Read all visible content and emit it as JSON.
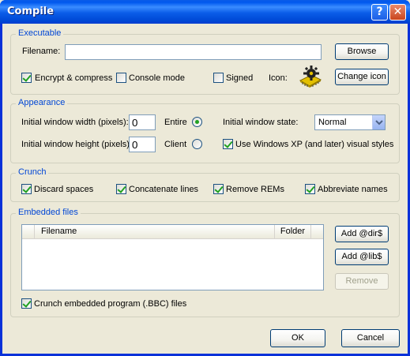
{
  "window": {
    "title": "Compile"
  },
  "titlebar": {
    "help_glyph": "?",
    "close_glyph": "✕"
  },
  "executable": {
    "group_title": "Executable",
    "filename_label": "Filename:",
    "filename_value": "",
    "browse_label": "Browse",
    "encrypt_label": "Encrypt & compress",
    "encrypt_checked": true,
    "console_label": "Console mode",
    "console_checked": false,
    "signed_label": "Signed",
    "signed_checked": false,
    "icon_label": "Icon:",
    "icon_name": "chip-gear-icon",
    "change_icon_label": "Change icon"
  },
  "appearance": {
    "group_title": "Appearance",
    "width_label": "Initial window width (pixels):",
    "width_value": "0",
    "height_label": "Initial window height (pixels):",
    "height_value": "0",
    "entire_label": "Entire",
    "entire_selected": true,
    "client_label": "Client",
    "client_selected": false,
    "state_label": "Initial window state:",
    "state_value": "Normal",
    "xp_styles_label": "Use Windows XP (and later) visual styles",
    "xp_styles_checked": true
  },
  "crunch": {
    "group_title": "Crunch",
    "discard_spaces": "Discard spaces",
    "concatenate_lines": "Concatenate lines",
    "remove_rems": "Remove REMs",
    "abbreviate_names": "Abbreviate names"
  },
  "embedded": {
    "group_title": "Embedded files",
    "columns": [
      "Filename",
      "Folder"
    ],
    "add_dir_label": "Add @dir$",
    "add_lib_label": "Add @lib$",
    "remove_label": "Remove",
    "crunch_bbc_label": "Crunch embedded program (.BBC) files"
  },
  "footer": {
    "ok_label": "OK",
    "cancel_label": "Cancel"
  },
  "colors": {
    "group_title": "#0046d5",
    "titlebar": "#0058ee",
    "check": "#21a121"
  }
}
